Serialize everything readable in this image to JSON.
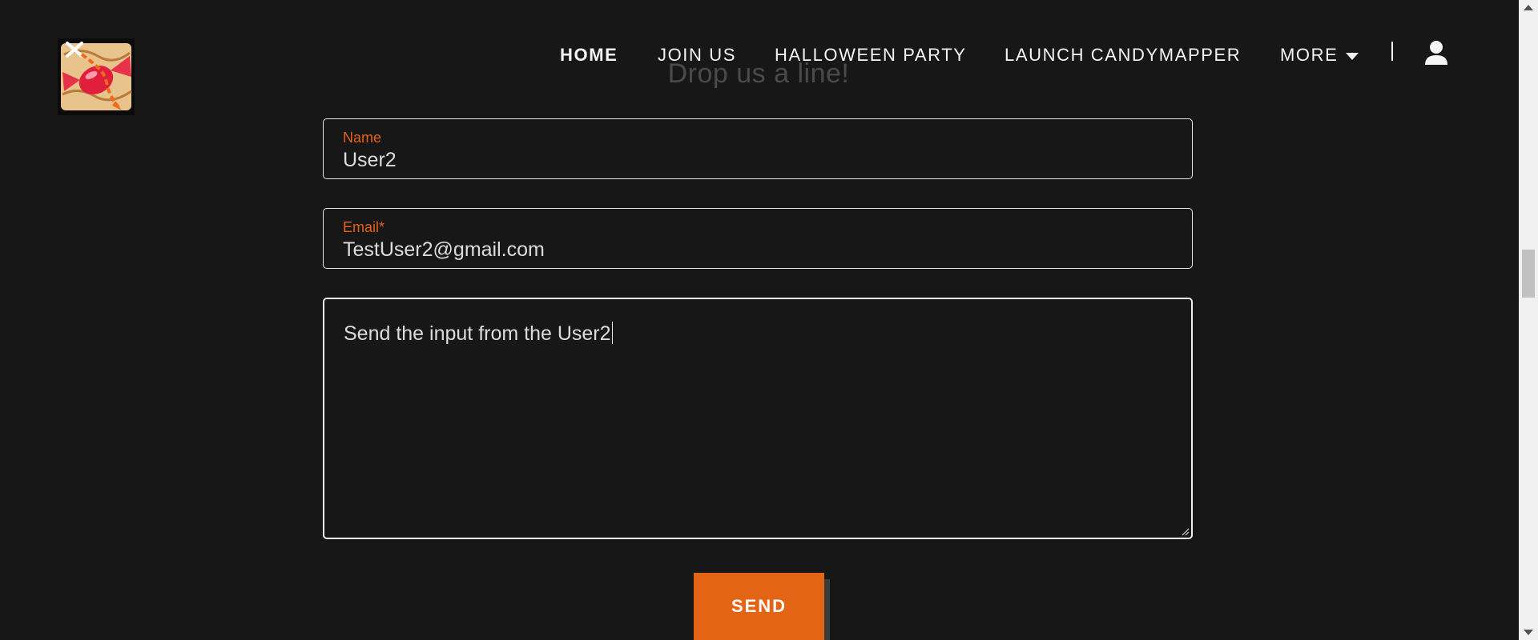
{
  "header": {
    "logo_icon": "candy-map-logo-icon",
    "nav": [
      {
        "label": "HOME",
        "active": true
      },
      {
        "label": "JOIN US",
        "active": false
      },
      {
        "label": "HALLOWEEN PARTY",
        "active": false
      },
      {
        "label": "LAUNCH CANDYMAPPER",
        "active": false
      }
    ],
    "more_label": "MORE",
    "account_icon": "user-account-icon"
  },
  "section": {
    "heading": "Drop us a line!"
  },
  "form": {
    "name": {
      "label": "Name",
      "value": "User2"
    },
    "email": {
      "label": "Email*",
      "value": "TestUser2@gmail.com"
    },
    "message": {
      "value": "Send the input from the User2"
    },
    "send_label": "SEND"
  },
  "colors": {
    "background": "#171717",
    "accent": "#e36414",
    "label": "#e5611a",
    "text": "#f4f4f4"
  }
}
